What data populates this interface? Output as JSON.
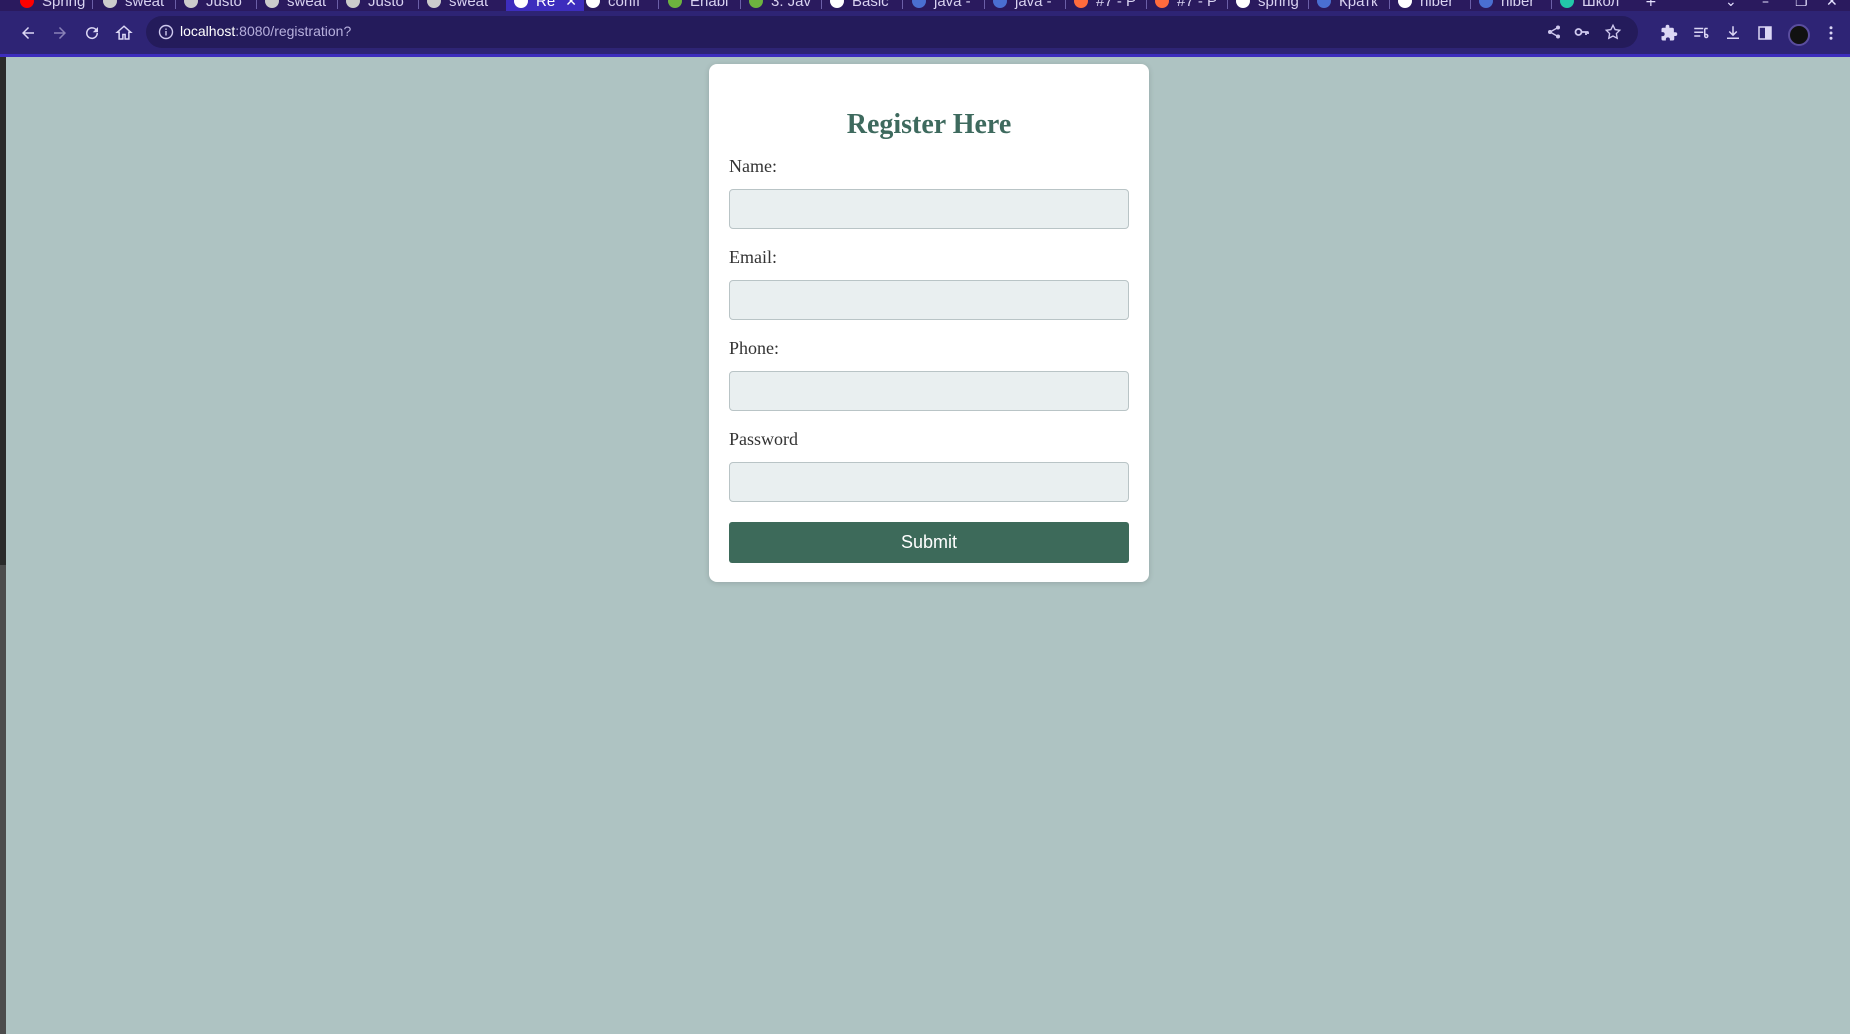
{
  "browser": {
    "tabs": [
      {
        "label": "Spring",
        "icon": "youtube-icon",
        "color": "#ff0000"
      },
      {
        "label": "sweat",
        "icon": "github-icon",
        "color": "#cccccc"
      },
      {
        "label": "Justo",
        "icon": "github-icon",
        "color": "#cccccc"
      },
      {
        "label": "sweat",
        "icon": "github-icon",
        "color": "#cccccc"
      },
      {
        "label": "Justo",
        "icon": "github-icon",
        "color": "#cccccc"
      },
      {
        "label": "sweat",
        "icon": "github-icon",
        "color": "#cccccc"
      },
      {
        "label": "Re",
        "icon": "globe-icon",
        "color": "#ffffff"
      },
      {
        "label": "confi",
        "icon": "chrome-icon",
        "color": "#ffffff"
      },
      {
        "label": "Enabl",
        "icon": "spring-icon",
        "color": "#6db33f"
      },
      {
        "label": "3. Jav",
        "icon": "spring-icon",
        "color": "#6db33f"
      },
      {
        "label": "Basic",
        "icon": "chrome-icon",
        "color": "#ffffff"
      },
      {
        "label": "java -",
        "icon": "doc-icon",
        "color": "#4a6fd1"
      },
      {
        "label": "java -",
        "icon": "doc-icon",
        "color": "#4a6fd1"
      },
      {
        "label": "#7 - P",
        "icon": "code-icon",
        "color": "#ff6b3d"
      },
      {
        "label": "#7 - P",
        "icon": "code-icon",
        "color": "#ff6b3d"
      },
      {
        "label": "spring",
        "icon": "chrome-icon",
        "color": "#ffffff"
      },
      {
        "label": "Кратк",
        "icon": "doc-icon",
        "color": "#4a6fd1"
      },
      {
        "label": "hiber",
        "icon": "chrome-icon",
        "color": "#ffffff"
      },
      {
        "label": "hiber",
        "icon": "doc-icon",
        "color": "#4a6fd1"
      },
      {
        "label": "Школ",
        "icon": "school-icon",
        "color": "#22c7a9"
      }
    ],
    "url_host": "localhost",
    "url_path": ":8080/registration?"
  },
  "form": {
    "title": "Register Here",
    "fields": [
      {
        "label": "Name:",
        "value": "",
        "type": "text"
      },
      {
        "label": "Email:",
        "value": "",
        "type": "email"
      },
      {
        "label": "Phone:",
        "value": "",
        "type": "tel"
      },
      {
        "label": "Password",
        "value": "",
        "type": "password"
      }
    ],
    "submit_label": "Submit"
  },
  "colors": {
    "page_background": "#aec3c2",
    "accent": "#3d6a5a",
    "title": "#3e6a5e",
    "input_background": "#e9eff0"
  }
}
